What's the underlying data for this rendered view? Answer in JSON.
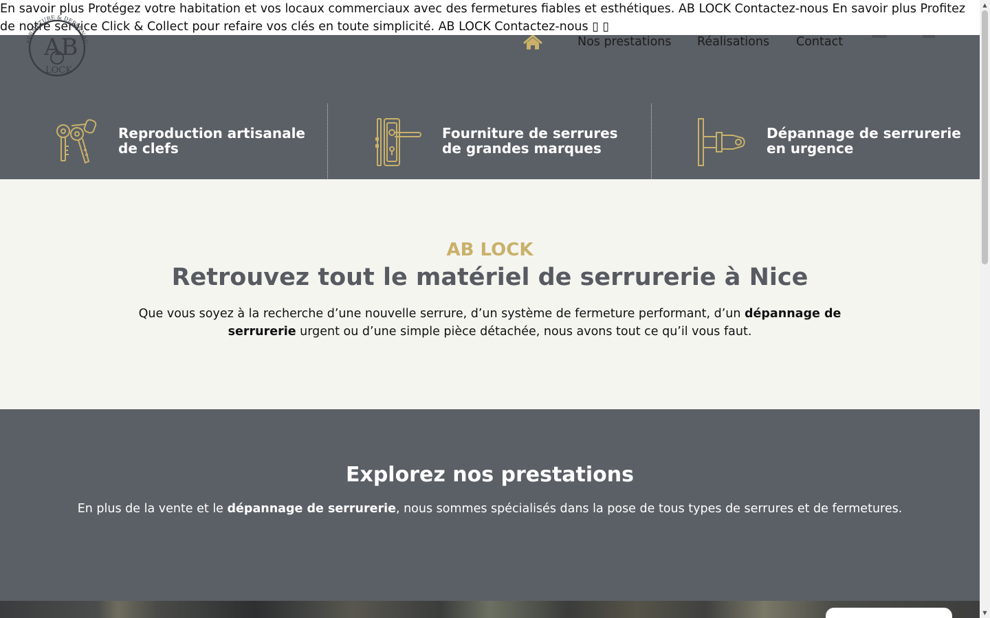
{
  "ticker": {
    "text": "En savoir plus Protégez votre habitation et vos locaux commerciaux avec des fermetures fiables et esthétiques. AB LOCK Contactez-nous En savoir plus Profitez de notre service Click & Collect pour refaire vos clés en toute simplicité. AB LOCK Contactez-nous ▯ ▯"
  },
  "logo": {
    "name": "AB",
    "sub": "LOCK",
    "arc": "FERMETURE & DEPANNAGE"
  },
  "nav": {
    "home_icon": "home-icon",
    "items": [
      {
        "label": "Nos prestations"
      },
      {
        "label": "Réalisations"
      },
      {
        "label": "Contact"
      }
    ]
  },
  "features": [
    {
      "icon": "keys-icon",
      "label": "Reproduction artisanale de clefs"
    },
    {
      "icon": "door-lock-icon",
      "label": "Fourniture de serrures de grandes marques"
    },
    {
      "icon": "key-lock-icon",
      "label": "Dépannage de serrurerie en urgence"
    }
  ],
  "intro": {
    "eyebrow": "AB LOCK",
    "title": "Retrouvez tout le matériel de serrurerie à Nice",
    "text_before": "Que vous soyez à la recherche d’une nouvelle serrure, d’un système de fermeture performant, d’un ",
    "text_bold": "dépannage de serrurerie",
    "text_after": " urgent ou d’une simple pièce détachée, nous avons tout ce qu’il vous faut."
  },
  "services": {
    "title": "Explorez nos prestations",
    "text_before": "En plus de la vente et le ",
    "text_bold": "dépannage de serrurerie",
    "text_after": ", nous sommes spécialisés dans la pose de tous types de serrures et de fermetures."
  },
  "colors": {
    "accent": "#c9b16a",
    "band": "#5b6066",
    "light_bg": "#f5f5f0",
    "title_gray": "#575b61"
  }
}
